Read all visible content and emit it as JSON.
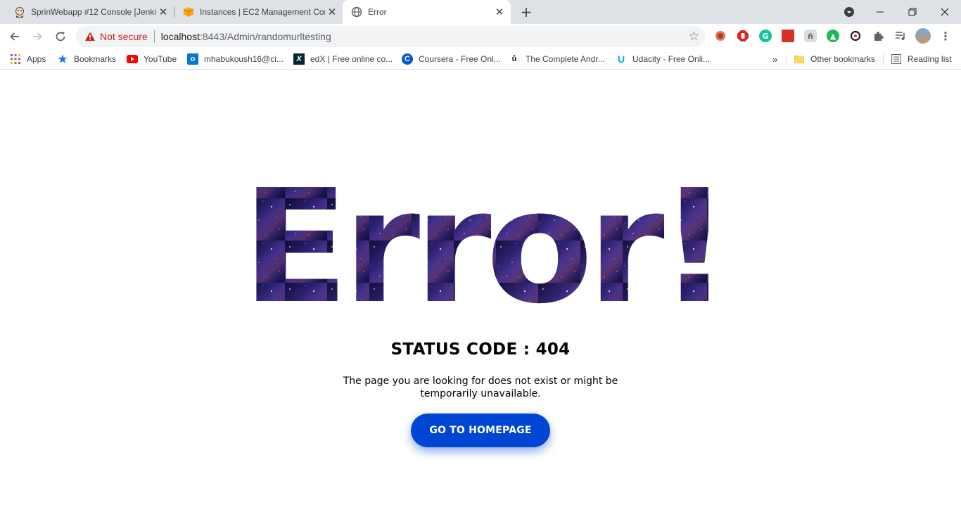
{
  "browser": {
    "tabs": [
      {
        "title": "SprinWebapp #12 Console [Jenkins]",
        "icon": "jenkins-icon"
      },
      {
        "title": "Instances | EC2 Management Console",
        "icon": "aws-box-icon"
      },
      {
        "title": "Error",
        "icon": "globe-icon"
      }
    ],
    "address": {
      "security_label": "Not secure",
      "url_host": "localhost",
      "url_path": ":8443/Admin/randomurltesting"
    },
    "bookmarks": [
      {
        "label": "Apps",
        "icon": "apps-grid-icon"
      },
      {
        "label": "Bookmarks",
        "icon": "star-icon"
      },
      {
        "label": "YouTube",
        "icon": "youtube-icon"
      },
      {
        "label": "mhabukoush16@ci...",
        "icon": "outlook-icon"
      },
      {
        "label": "edX | Free online co...",
        "icon": "edx-icon"
      },
      {
        "label": "Coursera - Free Onl...",
        "icon": "coursera-icon"
      },
      {
        "label": "The Complete Andr...",
        "icon": "udemy-icon"
      },
      {
        "label": "Udacity - Free Onli...",
        "icon": "udacity-icon"
      }
    ],
    "overflow_label": "»",
    "other_bookmarks": "Other bookmarks",
    "reading_list": "Reading list"
  },
  "page": {
    "headline": "Error!",
    "status": "STATUS CODE : 404",
    "message": "The page you are looking for does not exist or might be temporarily unavailable.",
    "button_label": "GO TO HOMEPAGE"
  },
  "colors": {
    "button": "#0046d5",
    "not_secure": "#c5221f",
    "tabstrip": "#dee1e6"
  }
}
